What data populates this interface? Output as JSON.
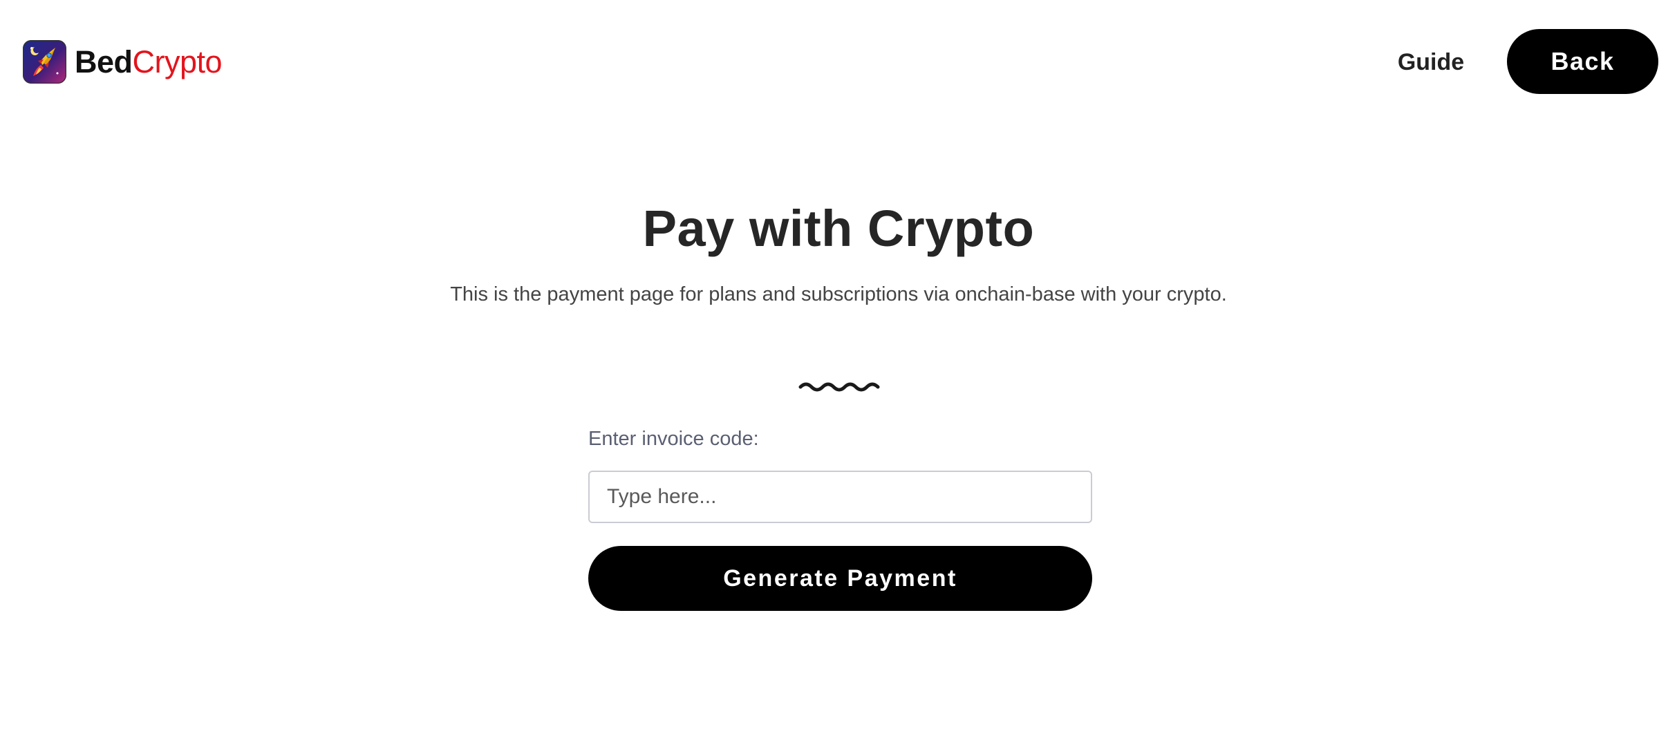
{
  "header": {
    "brand": {
      "part1": "Bed",
      "part2": "Crypto",
      "logo_icon": "rocket-icon"
    },
    "nav": {
      "guide_label": "Guide",
      "back_label": "Back"
    }
  },
  "main": {
    "title": "Pay with Crypto",
    "description": "This is the payment page for plans and subscriptions via onchain-base with your crypto.",
    "divider_icon": "wave-divider-icon",
    "form": {
      "invoice_label": "Enter invoice code:",
      "invoice_value": "",
      "invoice_placeholder": "Type here...",
      "submit_label": "Generate Payment"
    }
  },
  "colors": {
    "accent_red": "#e3141d",
    "button_bg": "#000000",
    "button_text": "#ffffff",
    "title_text": "#262626"
  }
}
